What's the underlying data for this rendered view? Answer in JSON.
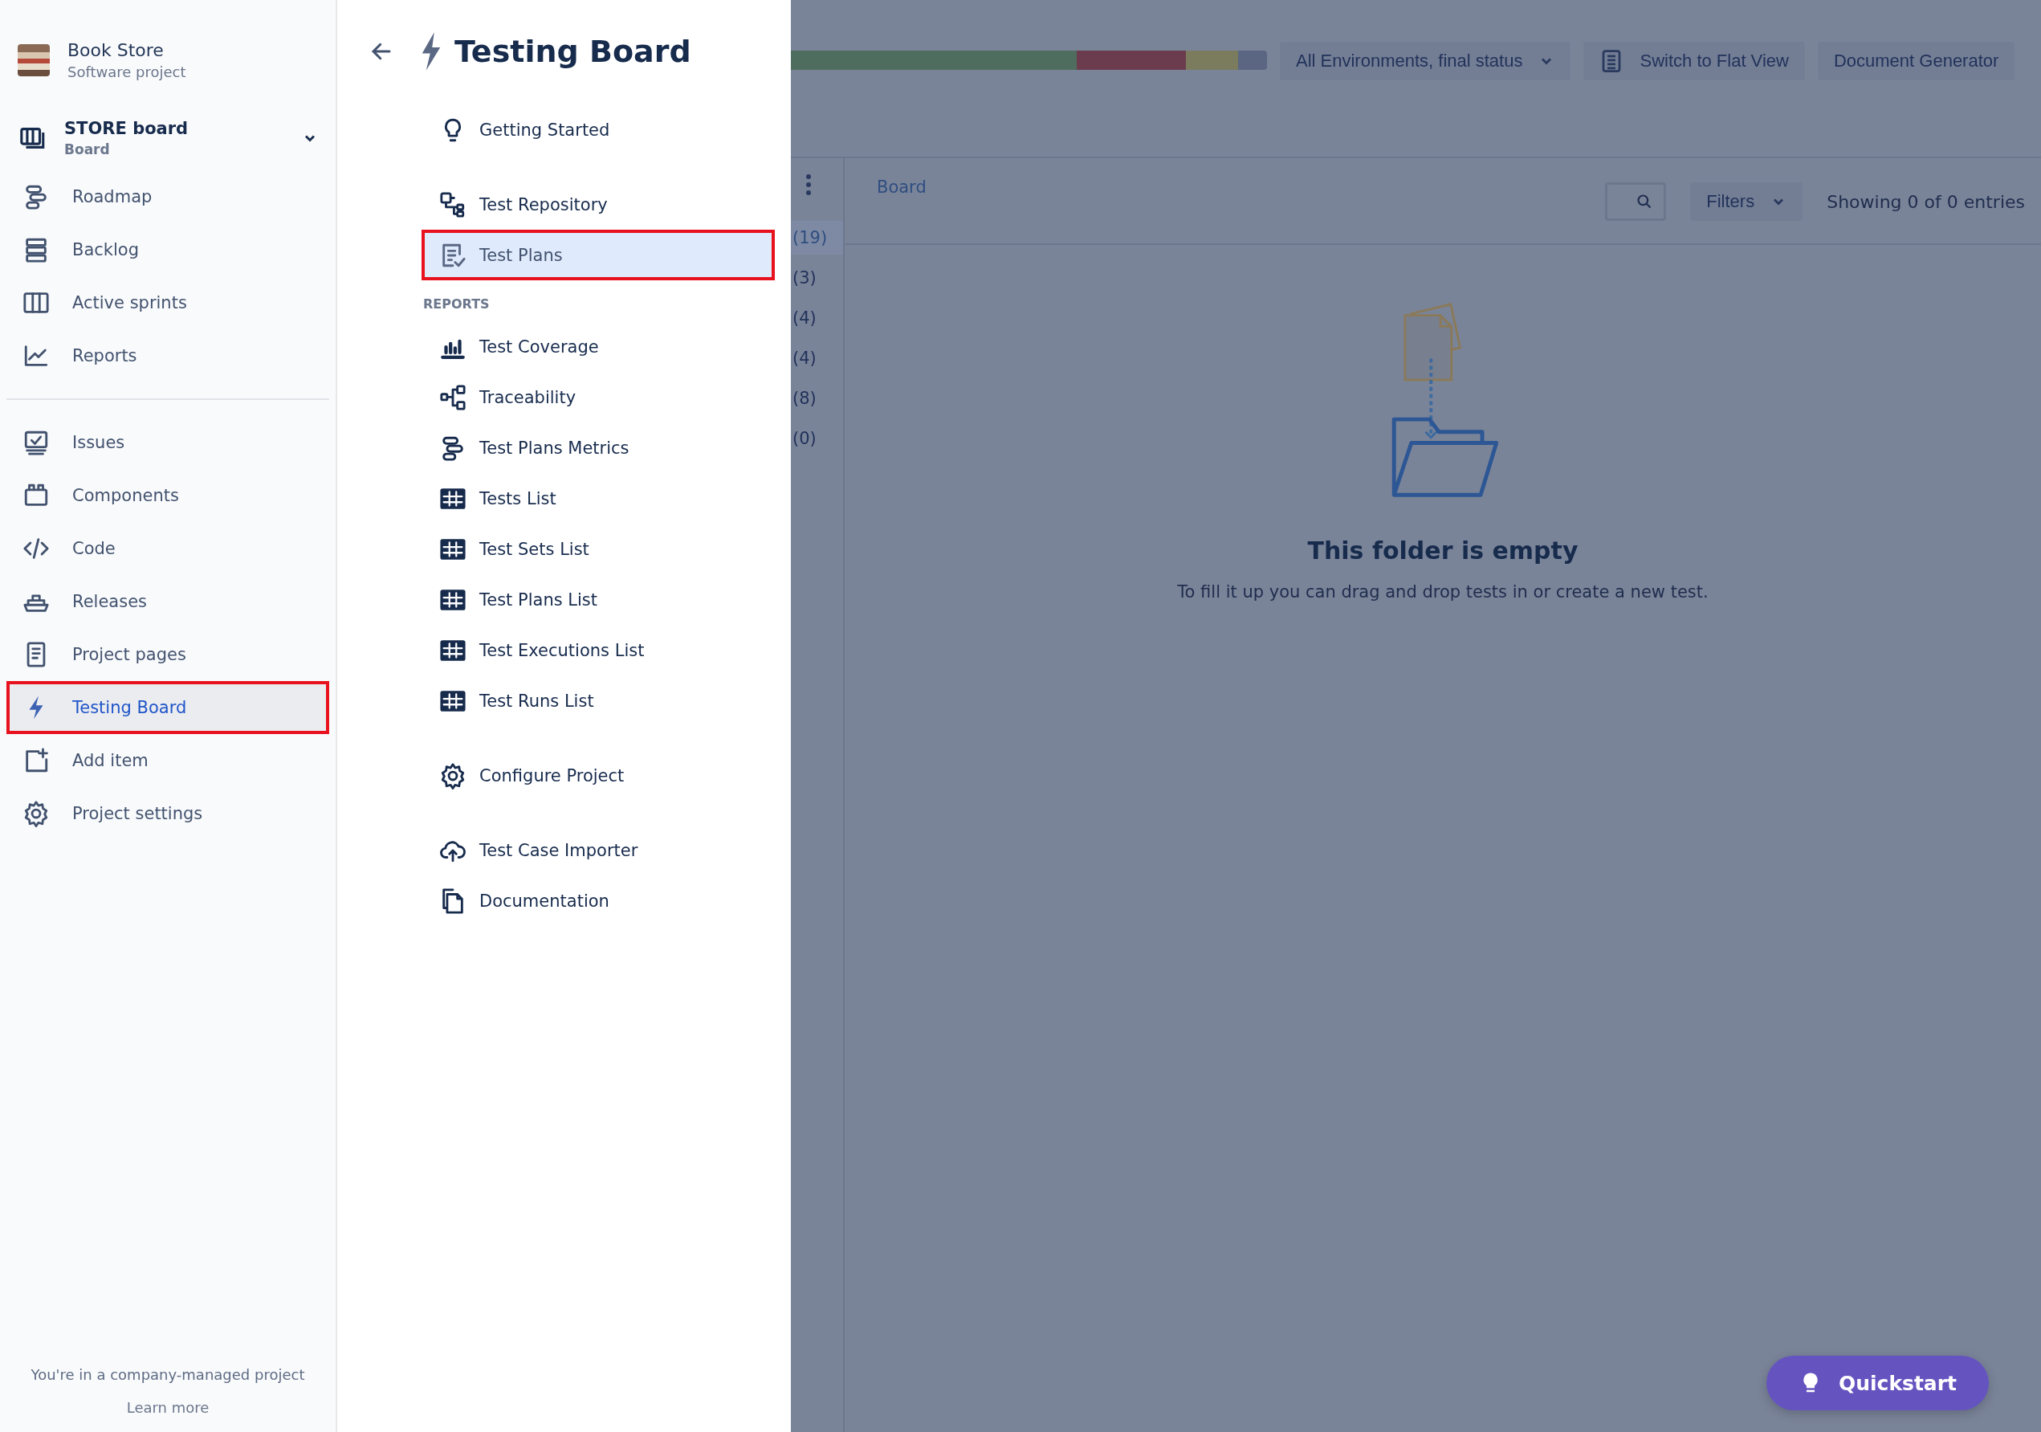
{
  "project": {
    "name": "Book Store",
    "type": "Software project"
  },
  "board": {
    "name": "STORE board",
    "type": "Board",
    "expanded": false
  },
  "sidebar": {
    "groups": [
      {
        "items": [
          {
            "label": "Roadmap",
            "selected": false,
            "outlined": false
          },
          {
            "label": "Backlog",
            "selected": false,
            "outlined": false
          },
          {
            "label": "Active sprints",
            "selected": false,
            "outlined": false
          },
          {
            "label": "Reports",
            "selected": false,
            "outlined": false
          }
        ]
      },
      {
        "items": [
          {
            "label": "Issues",
            "selected": false,
            "outlined": false
          },
          {
            "label": "Components",
            "selected": false,
            "outlined": false
          },
          {
            "label": "Code",
            "selected": false,
            "outlined": false
          },
          {
            "label": "Releases",
            "selected": false,
            "outlined": false
          },
          {
            "label": "Project pages",
            "selected": false,
            "outlined": false
          },
          {
            "label": "Testing Board",
            "selected": true,
            "outlined": true
          },
          {
            "label": "Add item",
            "selected": false,
            "outlined": false
          },
          {
            "label": "Project settings",
            "selected": false,
            "outlined": false
          }
        ]
      }
    ],
    "footer": {
      "text": "You're in a company-managed project",
      "link": "Learn more"
    }
  },
  "panel": {
    "title": "Testing Board",
    "sections": [
      {
        "items": [
          {
            "label": "Getting Started",
            "selected": false,
            "outlined": false
          }
        ]
      },
      {
        "items": [
          {
            "label": "Test Repository",
            "selected": false,
            "outlined": false
          },
          {
            "label": "Test Plans",
            "selected": true,
            "outlined": true
          }
        ]
      },
      {
        "heading": "REPORTS",
        "items": [
          {
            "label": "Test Coverage",
            "selected": false,
            "outlined": false
          },
          {
            "label": "Traceability",
            "selected": false,
            "outlined": false
          },
          {
            "label": "Test Plans Metrics",
            "selected": false,
            "outlined": false
          },
          {
            "label": "Tests List",
            "selected": false,
            "outlined": false
          },
          {
            "label": "Test Sets List",
            "selected": false,
            "outlined": false
          },
          {
            "label": "Test Plans List",
            "selected": false,
            "outlined": false
          },
          {
            "label": "Test Executions List",
            "selected": false,
            "outlined": false
          },
          {
            "label": "Test Runs List",
            "selected": false,
            "outlined": false
          }
        ]
      },
      {
        "items": [
          {
            "label": "Configure Project",
            "selected": false,
            "outlined": false
          }
        ]
      },
      {
        "items": [
          {
            "label": "Test Case Importer",
            "selected": false,
            "outlined": false
          },
          {
            "label": "Documentation",
            "selected": false,
            "outlined": false
          }
        ]
      }
    ]
  },
  "background": {
    "status_bar": [
      {
        "color": "#4f6d5e"
      },
      {
        "color": "#6a3c4d"
      },
      {
        "color": "#7b7c5e"
      },
      {
        "color": "#5b6682"
      }
    ],
    "environment_dropdown": "All Environments, final status",
    "buttons": [
      "Switch to Flat View",
      "Document Generator"
    ],
    "breadcrumb": "Board",
    "filters": "Filters",
    "entries": "Showing 0 of 0 entries",
    "counts": [
      {
        "label": "(19)",
        "selected": true
      },
      {
        "label": "(3)",
        "selected": false
      },
      {
        "label": "(4)",
        "selected": false
      },
      {
        "label": "(4)",
        "selected": false
      },
      {
        "label": "(8)",
        "selected": false
      },
      {
        "label": "(0)",
        "selected": false
      }
    ],
    "empty_title": "This folder is empty",
    "empty_text": "To fill it up you can drag and drop tests in or create a new test."
  },
  "quickstart": "Quickstart"
}
